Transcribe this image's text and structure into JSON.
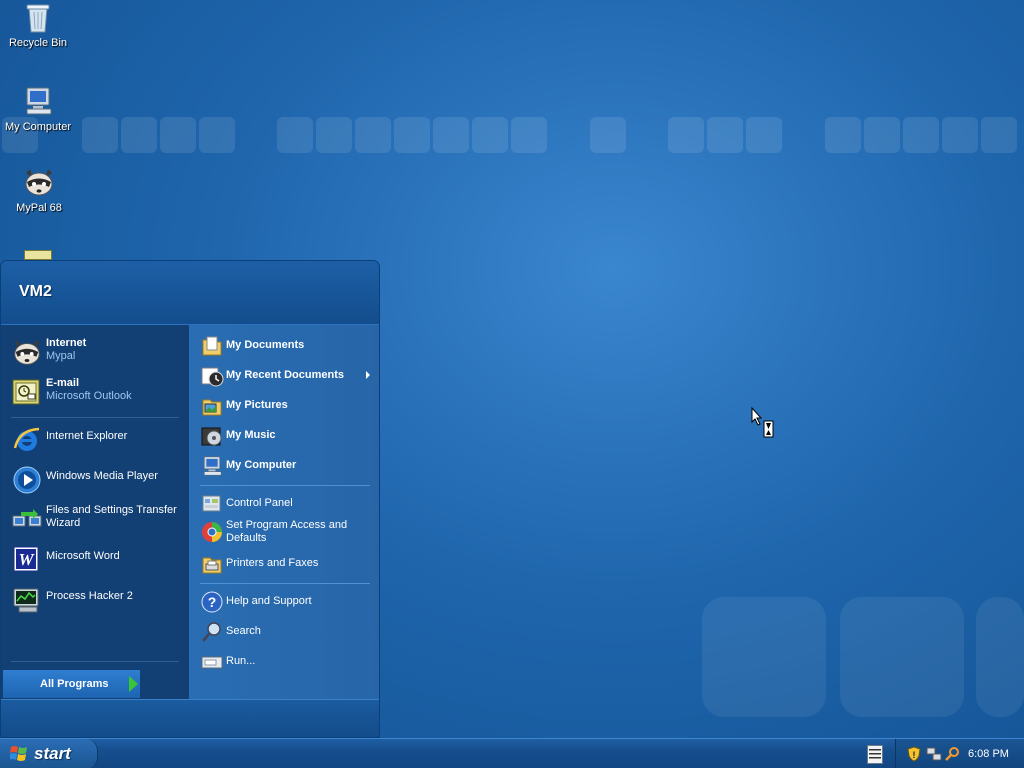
{
  "desktop": {
    "icons": [
      {
        "label": "Recycle Bin",
        "icon": "recycle-bin-icon"
      },
      {
        "label": "My Computer",
        "icon": "computer-icon"
      },
      {
        "label": "MyPal 68",
        "icon": "raccoon-browser-icon"
      }
    ]
  },
  "start_menu": {
    "user_name": "VM2",
    "pinned": [
      {
        "title": "Internet",
        "subtitle": "Mypal",
        "icon": "raccoon-browser-icon"
      },
      {
        "title": "E-mail",
        "subtitle": "Microsoft Outlook",
        "icon": "outlook-icon"
      }
    ],
    "recent": [
      {
        "label": "Internet Explorer",
        "icon": "internet-explorer-icon"
      },
      {
        "label": "Windows Media Player",
        "icon": "media-player-icon"
      },
      {
        "label": "Files and Settings Transfer Wizard",
        "icon": "transfer-wizard-icon"
      },
      {
        "label": "Microsoft Word",
        "icon": "word-icon"
      },
      {
        "label": "Process Hacker 2",
        "icon": "process-hacker-icon"
      }
    ],
    "all_programs": "All Programs",
    "places": [
      {
        "label": "My Documents",
        "icon": "documents-folder-icon"
      },
      {
        "label": "My Recent Documents",
        "icon": "recent-documents-icon"
      },
      {
        "label": "My Pictures",
        "icon": "pictures-folder-icon"
      },
      {
        "label": "My Music",
        "icon": "music-folder-icon"
      },
      {
        "label": "My Computer",
        "icon": "computer-icon"
      }
    ],
    "settings": [
      {
        "label": "Control Panel",
        "icon": "control-panel-icon"
      },
      {
        "label": "Set Program Access and Defaults",
        "icon": "program-defaults-icon"
      },
      {
        "label": "Printers and Faxes",
        "icon": "printer-icon"
      }
    ],
    "help": [
      {
        "label": "Help and Support",
        "icon": "help-icon"
      },
      {
        "label": "Search",
        "icon": "search-icon"
      },
      {
        "label": "Run...",
        "icon": "run-icon"
      }
    ]
  },
  "taskbar": {
    "start_label": "start",
    "clock": "6:08 PM",
    "tray_icons": [
      "security-shield-icon",
      "network-icon",
      "search-tray-icon"
    ]
  },
  "colors": {
    "desktop_blue": "#1f66ad",
    "start_menu_left": "#123f74",
    "start_menu_right": "#2a6db2",
    "all_programs_arrow": "#38c634"
  }
}
